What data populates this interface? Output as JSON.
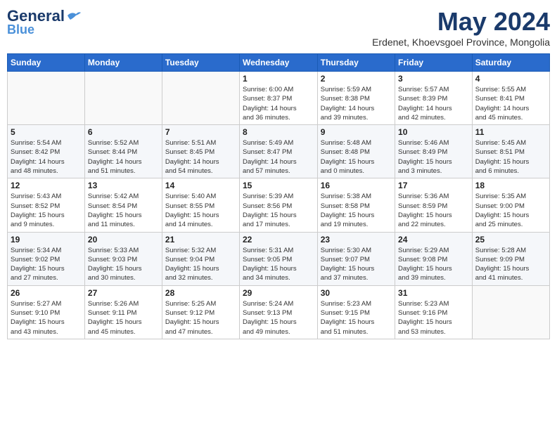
{
  "header": {
    "logo_general": "General",
    "logo_blue": "Blue",
    "month": "May 2024",
    "location": "Erdenet, Khoevsgoel Province, Mongolia"
  },
  "weekdays": [
    "Sunday",
    "Monday",
    "Tuesday",
    "Wednesday",
    "Thursday",
    "Friday",
    "Saturday"
  ],
  "weeks": [
    [
      {
        "day": "",
        "info": ""
      },
      {
        "day": "",
        "info": ""
      },
      {
        "day": "",
        "info": ""
      },
      {
        "day": "1",
        "info": "Sunrise: 6:00 AM\nSunset: 8:37 PM\nDaylight: 14 hours\nand 36 minutes."
      },
      {
        "day": "2",
        "info": "Sunrise: 5:59 AM\nSunset: 8:38 PM\nDaylight: 14 hours\nand 39 minutes."
      },
      {
        "day": "3",
        "info": "Sunrise: 5:57 AM\nSunset: 8:39 PM\nDaylight: 14 hours\nand 42 minutes."
      },
      {
        "day": "4",
        "info": "Sunrise: 5:55 AM\nSunset: 8:41 PM\nDaylight: 14 hours\nand 45 minutes."
      }
    ],
    [
      {
        "day": "5",
        "info": "Sunrise: 5:54 AM\nSunset: 8:42 PM\nDaylight: 14 hours\nand 48 minutes."
      },
      {
        "day": "6",
        "info": "Sunrise: 5:52 AM\nSunset: 8:44 PM\nDaylight: 14 hours\nand 51 minutes."
      },
      {
        "day": "7",
        "info": "Sunrise: 5:51 AM\nSunset: 8:45 PM\nDaylight: 14 hours\nand 54 minutes."
      },
      {
        "day": "8",
        "info": "Sunrise: 5:49 AM\nSunset: 8:47 PM\nDaylight: 14 hours\nand 57 minutes."
      },
      {
        "day": "9",
        "info": "Sunrise: 5:48 AM\nSunset: 8:48 PM\nDaylight: 15 hours\nand 0 minutes."
      },
      {
        "day": "10",
        "info": "Sunrise: 5:46 AM\nSunset: 8:49 PM\nDaylight: 15 hours\nand 3 minutes."
      },
      {
        "day": "11",
        "info": "Sunrise: 5:45 AM\nSunset: 8:51 PM\nDaylight: 15 hours\nand 6 minutes."
      }
    ],
    [
      {
        "day": "12",
        "info": "Sunrise: 5:43 AM\nSunset: 8:52 PM\nDaylight: 15 hours\nand 9 minutes."
      },
      {
        "day": "13",
        "info": "Sunrise: 5:42 AM\nSunset: 8:54 PM\nDaylight: 15 hours\nand 11 minutes."
      },
      {
        "day": "14",
        "info": "Sunrise: 5:40 AM\nSunset: 8:55 PM\nDaylight: 15 hours\nand 14 minutes."
      },
      {
        "day": "15",
        "info": "Sunrise: 5:39 AM\nSunset: 8:56 PM\nDaylight: 15 hours\nand 17 minutes."
      },
      {
        "day": "16",
        "info": "Sunrise: 5:38 AM\nSunset: 8:58 PM\nDaylight: 15 hours\nand 19 minutes."
      },
      {
        "day": "17",
        "info": "Sunrise: 5:36 AM\nSunset: 8:59 PM\nDaylight: 15 hours\nand 22 minutes."
      },
      {
        "day": "18",
        "info": "Sunrise: 5:35 AM\nSunset: 9:00 PM\nDaylight: 15 hours\nand 25 minutes."
      }
    ],
    [
      {
        "day": "19",
        "info": "Sunrise: 5:34 AM\nSunset: 9:02 PM\nDaylight: 15 hours\nand 27 minutes."
      },
      {
        "day": "20",
        "info": "Sunrise: 5:33 AM\nSunset: 9:03 PM\nDaylight: 15 hours\nand 30 minutes."
      },
      {
        "day": "21",
        "info": "Sunrise: 5:32 AM\nSunset: 9:04 PM\nDaylight: 15 hours\nand 32 minutes."
      },
      {
        "day": "22",
        "info": "Sunrise: 5:31 AM\nSunset: 9:05 PM\nDaylight: 15 hours\nand 34 minutes."
      },
      {
        "day": "23",
        "info": "Sunrise: 5:30 AM\nSunset: 9:07 PM\nDaylight: 15 hours\nand 37 minutes."
      },
      {
        "day": "24",
        "info": "Sunrise: 5:29 AM\nSunset: 9:08 PM\nDaylight: 15 hours\nand 39 minutes."
      },
      {
        "day": "25",
        "info": "Sunrise: 5:28 AM\nSunset: 9:09 PM\nDaylight: 15 hours\nand 41 minutes."
      }
    ],
    [
      {
        "day": "26",
        "info": "Sunrise: 5:27 AM\nSunset: 9:10 PM\nDaylight: 15 hours\nand 43 minutes."
      },
      {
        "day": "27",
        "info": "Sunrise: 5:26 AM\nSunset: 9:11 PM\nDaylight: 15 hours\nand 45 minutes."
      },
      {
        "day": "28",
        "info": "Sunrise: 5:25 AM\nSunset: 9:12 PM\nDaylight: 15 hours\nand 47 minutes."
      },
      {
        "day": "29",
        "info": "Sunrise: 5:24 AM\nSunset: 9:13 PM\nDaylight: 15 hours\nand 49 minutes."
      },
      {
        "day": "30",
        "info": "Sunrise: 5:23 AM\nSunset: 9:15 PM\nDaylight: 15 hours\nand 51 minutes."
      },
      {
        "day": "31",
        "info": "Sunrise: 5:23 AM\nSunset: 9:16 PM\nDaylight: 15 hours\nand 53 minutes."
      },
      {
        "day": "",
        "info": ""
      }
    ]
  ]
}
